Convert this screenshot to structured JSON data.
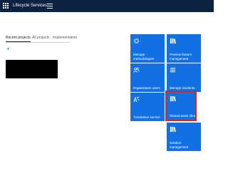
{
  "app": {
    "title": "Lifecycle Services"
  },
  "tabs": [
    {
      "label": "Recent projects",
      "active": true
    },
    {
      "label": "All projects",
      "active": false
    },
    {
      "label": "Implementation",
      "active": false
    }
  ],
  "actions": {
    "add_symbol": "+"
  },
  "tiles": [
    {
      "label": "Manage methodologies",
      "icon": "gear-icon"
    },
    {
      "label": "Preview feature management",
      "icon": "book-icon"
    },
    {
      "label": "Organization users",
      "icon": "users-icon"
    },
    {
      "label": "Manage incidents",
      "icon": "list-icon"
    },
    {
      "label": "Translation service",
      "icon": "translate-icon"
    },
    {
      "label": "Shared asset library",
      "icon": "book-icon",
      "highlighted": true
    },
    {
      "label": "Solution management",
      "icon": "book-icon"
    }
  ],
  "colors": {
    "topbar": "#0b2240",
    "tile": "#1270e3",
    "highlight": "#e2231a"
  }
}
